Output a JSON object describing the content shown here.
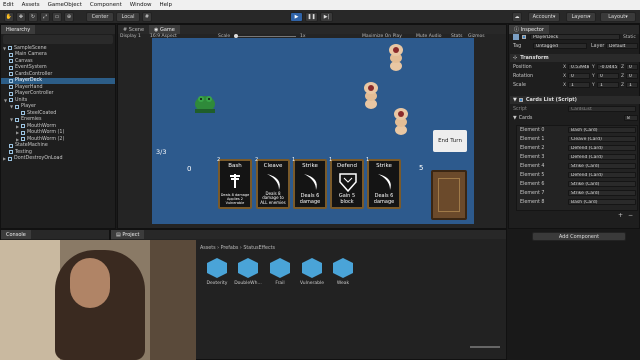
{
  "menubar": {
    "items": [
      "Edit",
      "Assets",
      "GameObject",
      "Component",
      "Window",
      "Help"
    ]
  },
  "toolbar": {
    "pivot": "Center",
    "space": "Local",
    "account": "Account",
    "layers": "Layers",
    "layout": "Layout"
  },
  "hierarchy": {
    "tab": "Hierarchy",
    "items": [
      {
        "label": "SampleScene",
        "indent": 0
      },
      {
        "label": "Main Camera",
        "indent": 1
      },
      {
        "label": "Canvas",
        "indent": 1
      },
      {
        "label": "EventSystem",
        "indent": 1
      },
      {
        "label": "CardsController",
        "indent": 1
      },
      {
        "label": "PlayerDeck",
        "indent": 1,
        "selected": true
      },
      {
        "label": "PlayerHand",
        "indent": 1
      },
      {
        "label": "PlayerController",
        "indent": 1
      },
      {
        "label": "Units",
        "indent": 1
      },
      {
        "label": "Player",
        "indent": 2
      },
      {
        "label": "SteelCoated",
        "indent": 3
      },
      {
        "label": "Enemies",
        "indent": 2
      },
      {
        "label": "MouthWorm",
        "indent": 3
      },
      {
        "label": "MouthWorm (1)",
        "indent": 3
      },
      {
        "label": "MouthWorm (2)",
        "indent": 3
      },
      {
        "label": "StateMachine",
        "indent": 1
      },
      {
        "label": "Testing",
        "indent": 1
      },
      {
        "label": "DontDestroyOnLoad",
        "indent": 0
      }
    ]
  },
  "scene_tabs": {
    "scene": "Scene",
    "game": "Game"
  },
  "game_toolbar": {
    "display": "Display 1",
    "aspect": "16:9 Aspect",
    "scale_label": "Scale",
    "scale_value": "1x",
    "maximize": "Maximize On Play",
    "mute": "Mute Audio",
    "stats": "Stats",
    "gizmos": "Gizmos"
  },
  "game": {
    "energy": "3/3",
    "draw_count": "0",
    "discard_count": "5",
    "end_turn": "End Turn",
    "cards": [
      {
        "cost": "2",
        "title": "Bash",
        "desc": "Deals 8 damage Applies 2 Vulnerable"
      },
      {
        "cost": "2",
        "title": "Cleave",
        "desc": "Deals 8 damage to ALL enemies"
      },
      {
        "cost": "1",
        "title": "Strike",
        "desc": "Deals 6 damage"
      },
      {
        "cost": "1",
        "title": "Defend",
        "desc": "Gain 5 block"
      },
      {
        "cost": "1",
        "title": "Strike",
        "desc": "Deals 6 damage"
      }
    ]
  },
  "inspector": {
    "tab": "Inspector",
    "object_name": "PlayerDeck",
    "static": "Static",
    "tag_label": "Tag",
    "tag_value": "Untagged",
    "layer_label": "Layer",
    "layer_value": "Default",
    "transform": "Transform",
    "position_label": "Position",
    "rotation_label": "Rotation",
    "scale_label": "Scale",
    "position": {
      "x": "0.53948",
      "y": "-0.0445",
      "z": "0"
    },
    "rotation": {
      "x": "0",
      "y": "0",
      "z": "0"
    },
    "scale": {
      "x": "1",
      "y": "1",
      "z": "1"
    },
    "component": "Cards List (Script)",
    "script_label": "Script",
    "script_value": "CardsList",
    "cards_label": "Cards",
    "cards_count": "8",
    "elements": [
      {
        "label": "Element 0",
        "value": "Bash (Card)"
      },
      {
        "label": "Element 1",
        "value": "Cleave (Card)"
      },
      {
        "label": "Element 2",
        "value": "Defend (Card)"
      },
      {
        "label": "Element 3",
        "value": "Defend (Card)"
      },
      {
        "label": "Element 4",
        "value": "Strike (Card)"
      },
      {
        "label": "Element 5",
        "value": "Defend (Card)"
      },
      {
        "label": "Element 6",
        "value": "Strike (Card)"
      },
      {
        "label": "Element 7",
        "value": "Strike (Card)"
      },
      {
        "label": "Element 8",
        "value": "Bash (Card)"
      }
    ],
    "add_component": "Add Component"
  },
  "bottom": {
    "console_tab": "Console",
    "project_tab": "Project",
    "collapse": "Collapse",
    "breadcrumb": [
      "Assets",
      "Prefabs",
      "StatusEffects"
    ],
    "assets": [
      "Dexterity",
      "DoubleWh...",
      "Frail",
      "Vulnerable",
      "Weak"
    ]
  },
  "colors": {
    "accent": "#2f63a8",
    "selection": "#2c5d87",
    "game_bg": "#2d5a8d",
    "cube": "#4aa4d8"
  }
}
